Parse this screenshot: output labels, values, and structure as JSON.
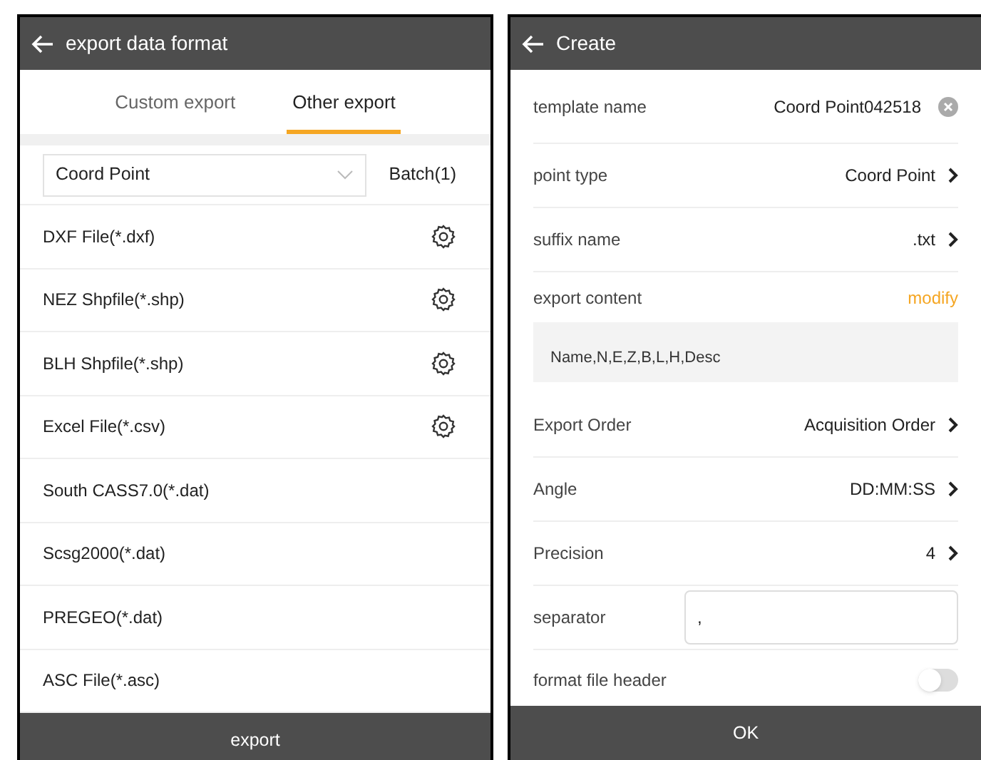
{
  "left": {
    "title": "export data format",
    "tabs": [
      {
        "label": "Custom export",
        "selected": false
      },
      {
        "label": "Other export",
        "selected": true
      }
    ],
    "dropdown": {
      "value": "Coord Point"
    },
    "batch": "Batch(1)",
    "formats": [
      {
        "label": "DXF File(*.dxf)",
        "settings": true
      },
      {
        "label": "NEZ Shpfile(*.shp)",
        "settings": true
      },
      {
        "label": "BLH Shpfile(*.shp)",
        "settings": true
      },
      {
        "label": "Excel File(*.csv)",
        "settings": true
      },
      {
        "label": "South CASS7.0(*.dat)",
        "settings": false
      },
      {
        "label": "Scsg2000(*.dat)",
        "settings": false
      },
      {
        "label": "PREGEO(*.dat)",
        "settings": false
      },
      {
        "label": "ASC File(*.asc)",
        "settings": false
      }
    ],
    "button": "export"
  },
  "right": {
    "title": "Create",
    "fields": [
      {
        "kind": "clearable",
        "label": "template name",
        "value": "Coord Point042518"
      },
      {
        "kind": "select",
        "label": "point type",
        "value": "Coord Point"
      },
      {
        "kind": "select",
        "label": "suffix name",
        "value": ".txt"
      },
      {
        "kind": "link",
        "label": "export content",
        "value": "modify"
      },
      {
        "kind": "content",
        "value": "Name,N,E,Z,B,L,H,Desc"
      },
      {
        "kind": "select",
        "label": "Export Order",
        "value": "Acquisition Order"
      },
      {
        "kind": "select",
        "label": "Angle",
        "value": "DD:MM:SS"
      },
      {
        "kind": "select",
        "label": "Precision",
        "value": "4"
      },
      {
        "kind": "input",
        "label": "separator",
        "value": ","
      },
      {
        "kind": "toggle",
        "label": "format file header",
        "on": false
      }
    ],
    "button": "OK"
  }
}
